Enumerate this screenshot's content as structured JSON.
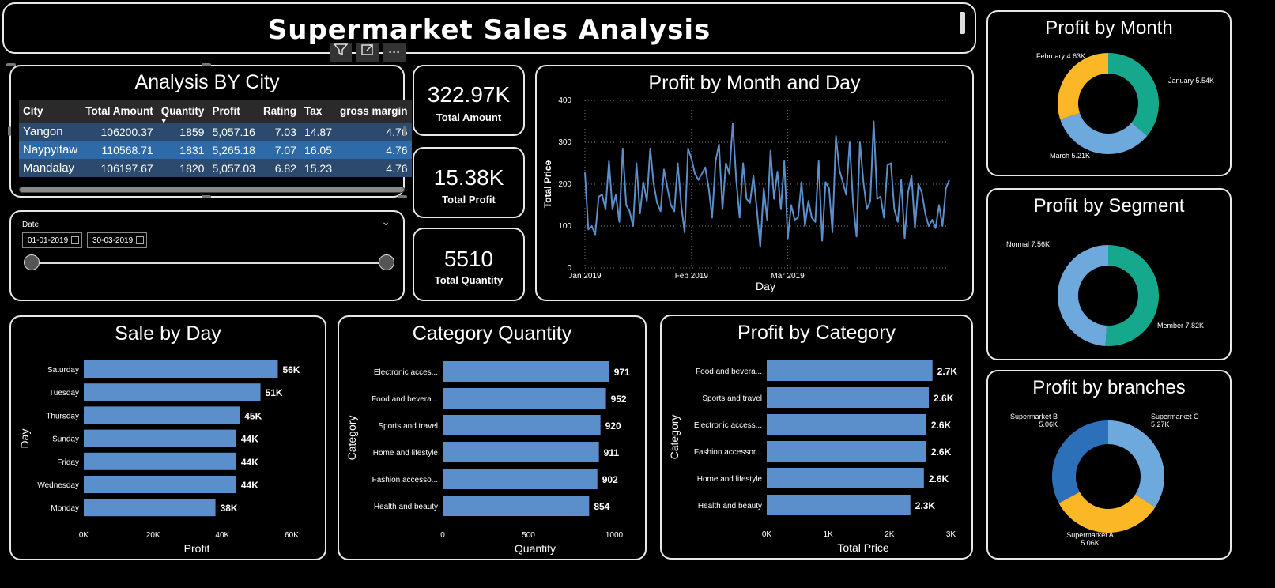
{
  "header": {
    "title": "Supermarket Sales Analysis"
  },
  "visual_toolbar": {
    "filter_icon": "filter-icon",
    "focus_icon": "focus-mode-icon",
    "more_label": "···"
  },
  "city_table": {
    "title": "Analysis BY City",
    "columns": [
      "City",
      "Total Amount",
      "Quantity",
      "Profit",
      "Rating",
      "Tax",
      "gross margin"
    ],
    "rows": [
      [
        "Yangon",
        "106200.37",
        "1859",
        "5,057.16",
        "7.03",
        "14.87",
        "4.76"
      ],
      [
        "Naypyitaw",
        "110568.71",
        "1831",
        "5,265.18",
        "7.07",
        "16.05",
        "4.76"
      ],
      [
        "Mandalay",
        "106197.67",
        "1820",
        "5,057.03",
        "6.82",
        "15.23",
        "4.76"
      ]
    ],
    "sort_indicator": "▼"
  },
  "date_slicer": {
    "label": "Date",
    "start": "01-01-2019",
    "end": "30-03-2019",
    "chevron": "⌄"
  },
  "kpis": [
    {
      "value": "322.97K",
      "label": "Total Amount"
    },
    {
      "value": "15.38K",
      "label": "Total Profit"
    },
    {
      "value": "5510",
      "label": "Total Quantity"
    }
  ],
  "colors": {
    "bar": "#5b8fcb",
    "teal": "#15a88d",
    "yellow": "#fbb725",
    "lightblue": "#6ea9de",
    "darkblue": "#2b70b8"
  },
  "chart_data": [
    {
      "id": "profit_by_month_and_day",
      "type": "line",
      "title": "Profit by Month and Day",
      "xlabel": "Day",
      "ylabel": "Total Price",
      "x_ticks": [
        "Jan 2019",
        "Feb 2019",
        "Mar 2019"
      ],
      "y_ticks": [
        "0",
        "100",
        "200",
        "300",
        "400"
      ],
      "ylim": [
        0,
        400
      ],
      "grid": true,
      "values": [
        228,
        92,
        100,
        80,
        170,
        175,
        140,
        255,
        140,
        175,
        110,
        285,
        150,
        135,
        100,
        250,
        130,
        205,
        160,
        285,
        200,
        155,
        135,
        235,
        190,
        150,
        135,
        250,
        150,
        85,
        285,
        260,
        225,
        210,
        225,
        240,
        190,
        120,
        255,
        295,
        140,
        250,
        225,
        345,
        210,
        120,
        250,
        165,
        155,
        220,
        140,
        50,
        190,
        115,
        280,
        165,
        230,
        140,
        255,
        70,
        150,
        115,
        120,
        205,
        100,
        160,
        120,
        110,
        255,
        65,
        205,
        190,
        85,
        315,
        235,
        205,
        175,
        300,
        155,
        75,
        300,
        205,
        140,
        160,
        350,
        165,
        170,
        120,
        245,
        250,
        140,
        110,
        210,
        70,
        180,
        220,
        95,
        200,
        180,
        130,
        100,
        115,
        95,
        150,
        100,
        190,
        210
      ],
      "series": [
        {
          "name": "",
          "color": "#5b8fcb"
        }
      ]
    },
    {
      "id": "sale_by_day",
      "type": "bar",
      "orientation": "horizontal",
      "title": "Sale by Day",
      "xlabel": "Profit",
      "ylabel": "Day",
      "categories": [
        "Saturday",
        "Tuesday",
        "Thursday",
        "Sunday",
        "Friday",
        "Wednesday",
        "Monday"
      ],
      "values": [
        56000,
        51000,
        45000,
        44000,
        44000,
        44000,
        38000
      ],
      "data_labels": [
        "56K",
        "51K",
        "45K",
        "44K",
        "44K",
        "44K",
        "38K"
      ],
      "x_ticks": [
        "0K",
        "20K",
        "40K",
        "60K"
      ],
      "xlim": [
        0,
        60000
      ]
    },
    {
      "id": "category_quantity",
      "type": "bar",
      "orientation": "horizontal",
      "title": "Category Quantity",
      "xlabel": "Quantity",
      "ylabel": "Category",
      "categories": [
        "Electronic acces...",
        "Food and bevera...",
        "Sports and travel",
        "Home and lifestyle",
        "Fashion accesso...",
        "Health and beauty"
      ],
      "values": [
        971,
        952,
        920,
        911,
        902,
        854
      ],
      "data_labels": [
        "971",
        "952",
        "920",
        "911",
        "902",
        "854"
      ],
      "x_ticks": [
        "0",
        "500",
        "1000"
      ],
      "xlim": [
        0,
        1000
      ]
    },
    {
      "id": "profit_by_category",
      "type": "bar",
      "orientation": "horizontal",
      "title": "Profit by Category",
      "xlabel": "Total Price",
      "ylabel": "Category",
      "categories": [
        "Food and bevera...",
        "Sports and travel",
        "Electronic access...",
        "Fashion accessor...",
        "Home and lifestyle",
        "Health and beauty"
      ],
      "values": [
        2700,
        2640,
        2600,
        2600,
        2560,
        2340
      ],
      "data_labels": [
        "2.7K",
        "2.6K",
        "2.6K",
        "2.6K",
        "2.6K",
        "2.3K"
      ],
      "x_ticks": [
        "0K",
        "1K",
        "2K",
        "3K"
      ],
      "xlim": [
        0,
        3000
      ]
    },
    {
      "id": "profit_by_month",
      "type": "pie",
      "donut": true,
      "title": "Profit by Month",
      "slices": [
        {
          "label": "January",
          "value": 5540,
          "display": "5.54K",
          "color": "#15a88d"
        },
        {
          "label": "March",
          "value": 5210,
          "display": "5.21K",
          "color": "#6ea9de"
        },
        {
          "label": "February",
          "value": 4630,
          "display": "4.63K",
          "color": "#fbb725"
        }
      ]
    },
    {
      "id": "profit_by_segment",
      "type": "pie",
      "donut": true,
      "title": "Profit by Segment",
      "slices": [
        {
          "label": "Member",
          "value": 7820,
          "display": "7.82K",
          "color": "#15a88d"
        },
        {
          "label": "Normal",
          "value": 7560,
          "display": "7.56K",
          "color": "#6ea9de"
        }
      ]
    },
    {
      "id": "profit_by_branches",
      "type": "pie",
      "donut": true,
      "title": "Profit by branches",
      "slices": [
        {
          "label": "Supermarket C",
          "value": 5270,
          "display": "5.27K",
          "color": "#6ea9de"
        },
        {
          "label": "Supermarket A",
          "value": 5060,
          "display": "5.06K",
          "color": "#fbb725"
        },
        {
          "label": "Supermarket B",
          "value": 5060,
          "display": "5.06K",
          "color": "#2b70b8"
        }
      ]
    }
  ]
}
